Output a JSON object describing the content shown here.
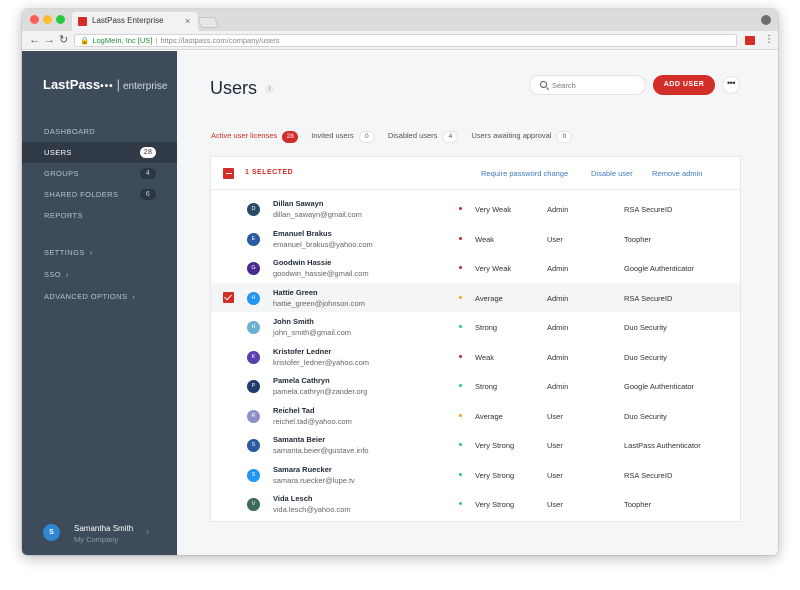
{
  "browser": {
    "tab_title": "LastPass Enterprise",
    "tab_close": "×",
    "secure_label": "LogMeIn, Inc [US]",
    "separator": "|",
    "url": "https://lastpass.com/company/users",
    "back_glyph": "←",
    "forward_glyph": "→",
    "reload_glyph": "↻",
    "lock_glyph": "🔒",
    "menu_glyph": "⋮",
    "traffic_colors": [
      "#fd5f57",
      "#febc2e",
      "#28c840"
    ]
  },
  "sidebar": {
    "logo_text": "LastPass",
    "logo_dots": "•••",
    "logo_bar": "|",
    "logo_suffix": "enterprise",
    "items": [
      {
        "label": "DASHBOARD",
        "badge": "",
        "chevron": ""
      },
      {
        "label": "USERS",
        "badge": "28",
        "chevron": ""
      },
      {
        "label": "GROUPS",
        "badge": "4",
        "chevron": ""
      },
      {
        "label": "SHARED FOLDERS",
        "badge": "6",
        "chevron": ""
      },
      {
        "label": "REPORTS",
        "badge": "",
        "chevron": ""
      },
      {
        "label": "SETTINGS",
        "badge": "",
        "chevron": "›"
      },
      {
        "label": "SSO",
        "badge": "",
        "chevron": "›"
      },
      {
        "label": "ADVANCED OPTIONS",
        "badge": "",
        "chevron": "›"
      }
    ],
    "user": {
      "initial": "S",
      "name": "Samantha Smith",
      "company": "My Company",
      "chevron": "›"
    }
  },
  "header": {
    "title": "Users",
    "info_glyph": "i",
    "search_placeholder": "Search",
    "add_user_label": "ADD USER",
    "more_glyph": "•••"
  },
  "filters": [
    {
      "label": "Active user licenses",
      "count": "28"
    },
    {
      "label": "Invited users",
      "count": "0"
    },
    {
      "label": "Disabled users",
      "count": "4"
    },
    {
      "label": "Users awaiting approval",
      "count": "0"
    }
  ],
  "selection": {
    "count_label": "1 SELECTED",
    "actions": [
      "Require password change",
      "Disable user",
      "Remove admin"
    ]
  },
  "colors": {
    "accent": "#d32d27",
    "weak": "#c62828",
    "average": "#f5a623",
    "strong": "#2ecc71"
  },
  "users": [
    {
      "initial": "D",
      "name": "Dillan Sawayn",
      "email": "dillan_sawayn@gmail.com",
      "strength": "Very Weak",
      "level": "weak",
      "role": "Admin",
      "mfa": "RSA SecureID",
      "avatar_color": "#2b4a66",
      "selected": false
    },
    {
      "initial": "E",
      "name": "Emanuel Brakus",
      "email": "emanuel_brakus@yahoo.com",
      "strength": "Weak",
      "level": "weak",
      "role": "User",
      "mfa": "Toopher",
      "avatar_color": "#2c5aa0",
      "selected": false
    },
    {
      "initial": "G",
      "name": "Goodwin Hassie",
      "email": "goodwin_hassie@gmail.com",
      "strength": "Very Weak",
      "level": "weak",
      "role": "Admin",
      "mfa": "Google Authenticator",
      "avatar_color": "#4b2a8e",
      "selected": false
    },
    {
      "initial": "H",
      "name": "Hattie Green",
      "email": "hattie_green@johnson.com",
      "strength": "Average",
      "level": "average",
      "role": "Admin",
      "mfa": "RSA SecureID",
      "avatar_color": "#2196f3",
      "selected": true
    },
    {
      "initial": "H",
      "name": "John Smith",
      "email": "john_smith@gmail.com",
      "strength": "Strong",
      "level": "strong",
      "role": "Admin",
      "mfa": "Duo Security",
      "avatar_color": "#6aaed0",
      "selected": false
    },
    {
      "initial": "K",
      "name": "Kristofer Ledner",
      "email": "kristofer_ledner@yahoo.com",
      "strength": "Weak",
      "level": "weak",
      "role": "Admin",
      "mfa": "Duo Security",
      "avatar_color": "#5a3fb0",
      "selected": false
    },
    {
      "initial": "P",
      "name": "Pamela Cathryn",
      "email": "pamela.cathryn@zander.org",
      "strength": "Strong",
      "level": "strong",
      "role": "Admin",
      "mfa": "Google Authenticator",
      "avatar_color": "#223b6e",
      "selected": false
    },
    {
      "initial": "R",
      "name": "Reichel Tad",
      "email": "reichel.tad@yahoo.com",
      "strength": "Average",
      "level": "average",
      "role": "User",
      "mfa": "Duo Security",
      "avatar_color": "#8c8fc6",
      "selected": false
    },
    {
      "initial": "S",
      "name": "Samanta Beier",
      "email": "samanta.beier@gustave.info",
      "strength": "Very Strong",
      "level": "strong",
      "role": "User",
      "mfa": "LastPass Authenticator",
      "avatar_color": "#2c5aa0",
      "selected": false
    },
    {
      "initial": "S",
      "name": "Samara Ruecker",
      "email": "samara.ruecker@lupe.tv",
      "strength": "Very Strong",
      "level": "strong",
      "role": "User",
      "mfa": "RSA SecureID",
      "avatar_color": "#2196f3",
      "selected": false
    },
    {
      "initial": "V",
      "name": "Vida Lesch",
      "email": "vida.lesch@yahoo.com",
      "strength": "Very Strong",
      "level": "strong",
      "role": "User",
      "mfa": "Toopher",
      "avatar_color": "#3d6a5a",
      "selected": false
    }
  ]
}
